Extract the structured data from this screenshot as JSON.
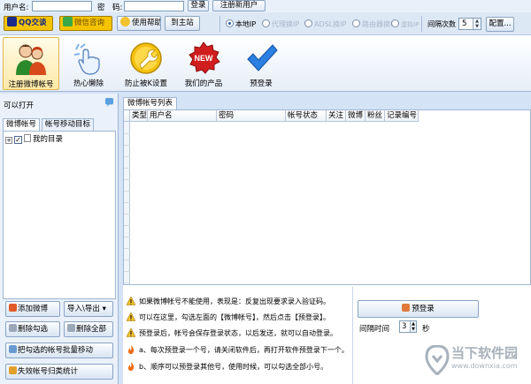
{
  "topbar": {
    "username_label": "用户名:",
    "password_label": "密　码:",
    "login_button": "登录",
    "register_button": "注册新用户"
  },
  "toolbar": {
    "qq_button": "QQ交谈",
    "wechat_button": "微信咨询",
    "help_button": "使用帮助",
    "homepage_button": "到主站",
    "ip_options": [
      "本地IP",
      "代理换IP",
      "ADSL换IP",
      "路由器换IP",
      "虚拟IP"
    ],
    "ip_selected": "本地IP",
    "interval_label": "间隔次数",
    "interval_value": "5",
    "config_button": "配置..."
  },
  "bigtools": [
    {
      "label": "注册微博帐号",
      "icon": "users-icon"
    },
    {
      "label": "热心懒除",
      "icon": "hand-click-icon"
    },
    {
      "label": "防止被K设置",
      "icon": "wrench-icon"
    },
    {
      "label": "我们的产品",
      "icon": "new-badge-icon"
    },
    {
      "label": "预登录",
      "icon": "checkmark-icon"
    }
  ],
  "left": {
    "header": "可以打开",
    "tabs": [
      "微博帐号",
      "帐号移动目标"
    ],
    "tree_root": "我的目录",
    "buttons": {
      "add": "添加微博",
      "import_export": "导入\\导出",
      "delete_checked": "删除勾选",
      "delete_all": "删除全部",
      "move_checked": "把勾选的帐号批量移动",
      "stats": "失效帐号归类统计"
    }
  },
  "main": {
    "tab": "微博帐号列表",
    "columns": [
      "类型",
      "用户名",
      "密码",
      "帐号状态",
      "关注",
      "微博",
      "粉丝",
      "记录编号"
    ]
  },
  "tips": [
    {
      "icon": "warning-icon",
      "text": "如果微博帐号不能使用，表现是：反复出现要求录入验证码。"
    },
    {
      "icon": "warning-icon",
      "text": "可以在这里，勾选左面的【微博帐号】，然后点击【预登录】。"
    },
    {
      "icon": "warning-icon",
      "text": "预登录后，帐号会保存登录状态，以后发送，就可以自动登录。"
    },
    {
      "icon": "fire-icon",
      "text": "a、每次预登录一个号，请关闭软件后，再打开软件预登录下一个。"
    },
    {
      "icon": "fire-icon",
      "text": "b、顺序可以预登录其他号，使用时候，可以勾选全部小号。"
    }
  ],
  "prelogin": {
    "button": "预登录",
    "interval_label": "间隔时间",
    "interval_value": "3",
    "unit": "秒"
  },
  "watermark": {
    "title": "当下软件园",
    "subtitle": "www.downxia.com"
  }
}
